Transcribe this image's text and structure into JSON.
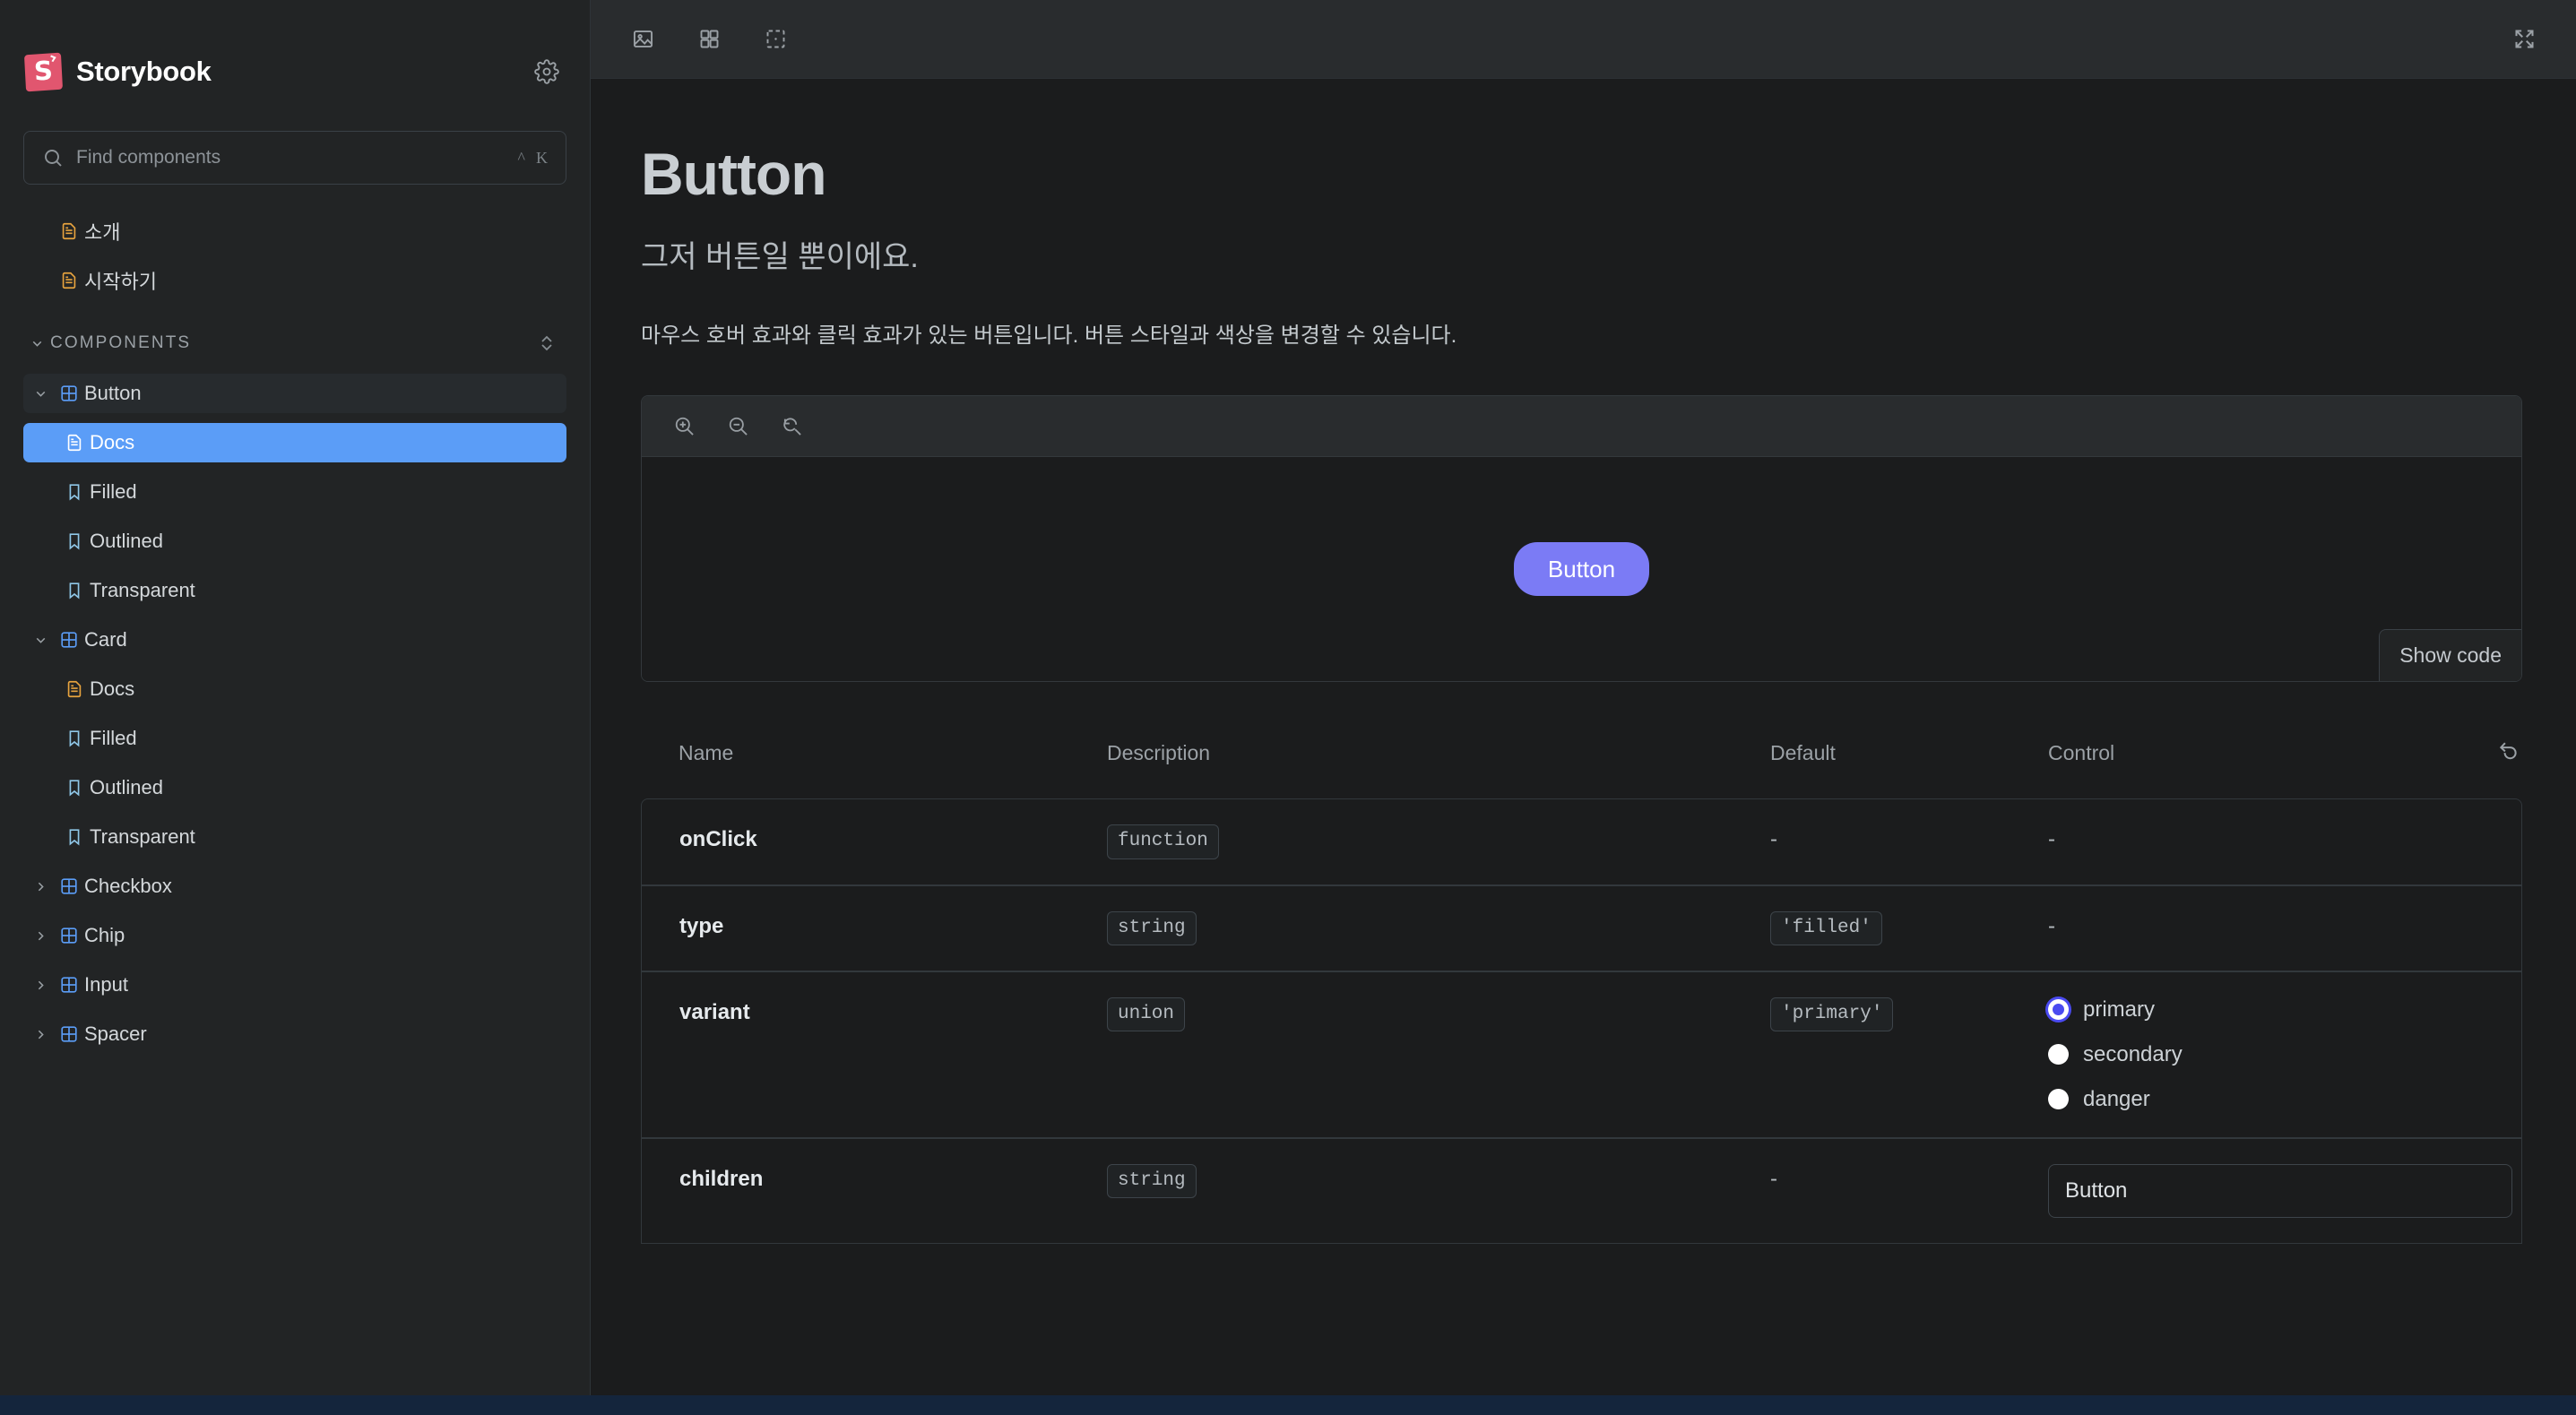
{
  "sidebar": {
    "brand": {
      "name": "Storybook",
      "logo_color": "#e1566f",
      "settings_icon": "gear-icon"
    },
    "search": {
      "placeholder": "Find components",
      "value": "",
      "shortcut_modifier": "^",
      "shortcut_key": "K"
    },
    "top_items": [
      {
        "label": "소개",
        "icon": "document-icon"
      },
      {
        "label": "시작하기",
        "icon": "document-icon"
      }
    ],
    "section": {
      "title": "COMPONENTS",
      "expand_icon": "expand-collapse-icon"
    },
    "tree": [
      {
        "label": "Button",
        "type": "component",
        "expanded": true,
        "level": 1,
        "children": [
          {
            "label": "Docs",
            "type": "docs",
            "level": 2,
            "selected": true
          },
          {
            "label": "Filled",
            "type": "story",
            "level": 2,
            "selected": false
          },
          {
            "label": "Outlined",
            "type": "story",
            "level": 2,
            "selected": false
          },
          {
            "label": "Transparent",
            "type": "story",
            "level": 2,
            "selected": false
          }
        ]
      },
      {
        "label": "Card",
        "type": "component",
        "expanded": true,
        "level": 1,
        "children": [
          {
            "label": "Docs",
            "type": "docs",
            "level": 2,
            "selected": false
          },
          {
            "label": "Filled",
            "type": "story",
            "level": 2,
            "selected": false
          },
          {
            "label": "Outlined",
            "type": "story",
            "level": 2,
            "selected": false
          },
          {
            "label": "Transparent",
            "type": "story",
            "level": 2,
            "selected": false
          }
        ]
      },
      {
        "label": "Checkbox",
        "type": "component",
        "expanded": false,
        "level": 1,
        "children": []
      },
      {
        "label": "Chip",
        "type": "component",
        "expanded": false,
        "level": 1,
        "children": []
      },
      {
        "label": "Input",
        "type": "component",
        "expanded": false,
        "level": 1,
        "children": []
      },
      {
        "label": "Spacer",
        "type": "component",
        "expanded": false,
        "level": 1,
        "children": []
      }
    ]
  },
  "toolbar": {
    "buttons": [
      {
        "name": "image-icon",
        "label": "Change background"
      },
      {
        "name": "grid-icon",
        "label": "Apply a grid to the preview"
      },
      {
        "name": "measure-icon",
        "label": "Enable measure"
      }
    ],
    "fullscreen": {
      "name": "fullscreen-icon",
      "label": "Go full screen"
    }
  },
  "doc": {
    "title": "Button",
    "subtitle": "그저 버튼일 뿐이에요.",
    "description": "마우스 호버 효과와 클릭 효과가 있는 버튼입니다. 버튼 스타일과 색상을 변경할 수 있습니다.",
    "preview": {
      "zoom_in": "zoom-in-icon",
      "zoom_out": "zoom-out-icon",
      "zoom_reset": "zoom-reset-icon",
      "demo_button_label": "Button",
      "demo_button_color": "#7b7bf5",
      "show_code_label": "Show code"
    }
  },
  "args_table": {
    "headers": {
      "name": "Name",
      "description": "Description",
      "default": "Default",
      "control": "Control",
      "reset_icon": "reset-icon"
    },
    "rows": [
      {
        "name": "onClick",
        "description_badge": "function",
        "default": "-",
        "control_type": "none",
        "control_value": "-"
      },
      {
        "name": "type",
        "description_badge": "string",
        "default": "'filled'",
        "control_type": "none",
        "control_value": "-"
      },
      {
        "name": "variant",
        "description_badge": "union",
        "default": "'primary'",
        "control_type": "radio",
        "options": [
          {
            "label": "primary",
            "selected": true
          },
          {
            "label": "secondary",
            "selected": false
          },
          {
            "label": "danger",
            "selected": false
          }
        ]
      },
      {
        "name": "children",
        "description_badge": "string",
        "default": "-",
        "control_type": "text",
        "control_value": "Button"
      }
    ]
  },
  "colors": {
    "accent_blue": "#5b9df7",
    "sidebar_bg": "#222425",
    "main_bg": "#1b1c1d",
    "selected_radio": "#4a4af0",
    "story_icon": "#8fc7e8",
    "docs_icon": "#e7a33e",
    "component_icon": "#5b9df7"
  }
}
